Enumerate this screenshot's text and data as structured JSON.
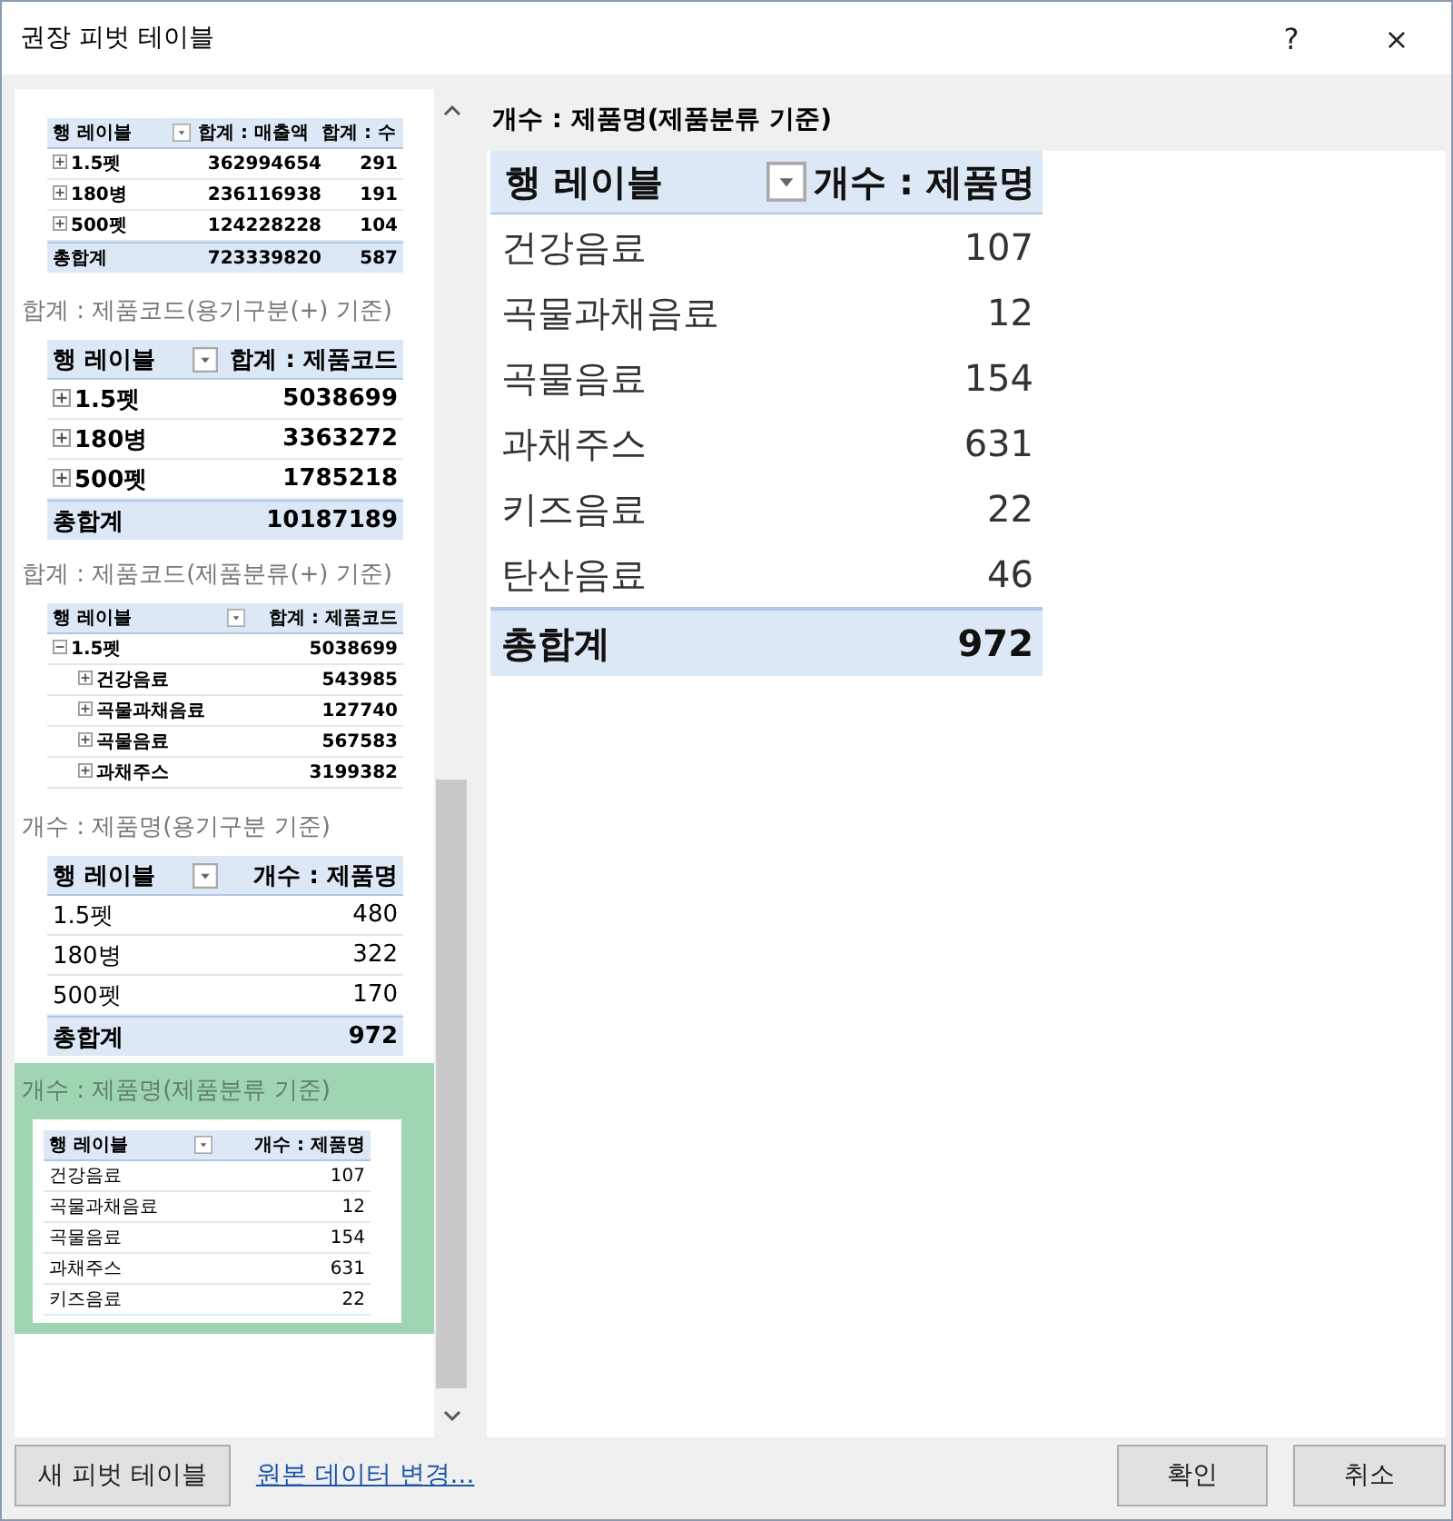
{
  "window": {
    "title": "권장 피벗 테이블",
    "help": "?",
    "close": "×"
  },
  "recommendations": [
    {
      "kind": "compact",
      "selected": false,
      "table": {
        "bold_rows": true,
        "headers": [
          "행 레이블",
          "합계 : 매출액",
          "합계 : 수"
        ],
        "rows": [
          {
            "label": "1.5펫",
            "values": [
              "362994654",
              "291"
            ],
            "expanded": false
          },
          {
            "label": "180병",
            "values": [
              "236116938",
              "191"
            ],
            "expanded": false
          },
          {
            "label": "500펫",
            "values": [
              "124228228",
              "104"
            ],
            "expanded": false
          }
        ],
        "total": {
          "label": "총합계",
          "values": [
            "723339820",
            "587"
          ]
        }
      }
    },
    {
      "kind": "full",
      "selected": false,
      "title": "합계 : 제품코드(용기구분(+) 기준)",
      "table": {
        "bold_rows": true,
        "headers": [
          "행 레이블",
          "합계 : 제품코드"
        ],
        "rows": [
          {
            "label": "1.5펫",
            "values": [
              "5038699"
            ],
            "expanded": false
          },
          {
            "label": "180병",
            "values": [
              "3363272"
            ],
            "expanded": false
          },
          {
            "label": "500펫",
            "values": [
              "1785218"
            ],
            "expanded": false
          }
        ],
        "total": {
          "label": "총합계",
          "values": [
            "10187189"
          ]
        }
      }
    },
    {
      "kind": "compact",
      "selected": false,
      "title": "합계 : 제품코드(제품분류(+) 기준)",
      "table": {
        "bold_rows": true,
        "headers": [
          "행 레이블",
          "합계 : 제품코드"
        ],
        "rows": [
          {
            "label": "1.5펫",
            "values": [
              "5038699"
            ],
            "expanded": true,
            "children": [
              {
                "label": "건강음료",
                "values": [
                  "543985"
                ],
                "expanded": false
              },
              {
                "label": "곡물과채음료",
                "values": [
                  "127740"
                ],
                "expanded": false
              },
              {
                "label": "곡물음료",
                "values": [
                  "567583"
                ],
                "expanded": false
              },
              {
                "label": "과채주스",
                "values": [
                  "3199382"
                ],
                "expanded": false
              }
            ]
          }
        ]
      }
    },
    {
      "kind": "full",
      "selected": false,
      "title": "개수 : 제품명(용기구분 기준)",
      "table": {
        "bold_rows": false,
        "headers": [
          "행 레이블",
          "개수 : 제품명"
        ],
        "rows": [
          {
            "label": "1.5펫",
            "values": [
              "480"
            ]
          },
          {
            "label": "180병",
            "values": [
              "322"
            ]
          },
          {
            "label": "500펫",
            "values": [
              "170"
            ]
          }
        ],
        "total": {
          "label": "총합계",
          "values": [
            "972"
          ]
        }
      }
    },
    {
      "kind": "compact",
      "selected": true,
      "title": "개수 : 제품명(제품분류 기준)",
      "table": {
        "bold_rows": false,
        "headers": [
          "행 레이블",
          "개수 : 제품명"
        ],
        "rows": [
          {
            "label": "건강음료",
            "values": [
              "107"
            ]
          },
          {
            "label": "곡물과채음료",
            "values": [
              "12"
            ]
          },
          {
            "label": "곡물음료",
            "values": [
              "154"
            ]
          },
          {
            "label": "과채주스",
            "values": [
              "631"
            ]
          },
          {
            "label": "키즈음료",
            "values": [
              "22"
            ]
          }
        ]
      }
    }
  ],
  "preview": {
    "title": "개수 : 제품명(제품분류 기준)",
    "headers": [
      "행 레이블",
      "개수 : 제품명"
    ],
    "rows": [
      {
        "label": "건강음료",
        "value": "107"
      },
      {
        "label": "곡물과채음료",
        "value": "12"
      },
      {
        "label": "곡물음료",
        "value": "154"
      },
      {
        "label": "과채주스",
        "value": "631"
      },
      {
        "label": "키즈음료",
        "value": "22"
      },
      {
        "label": "탄산음료",
        "value": "46"
      }
    ],
    "total": {
      "label": "총합계",
      "value": "972"
    }
  },
  "footer": {
    "new_button": "새 피벗 테이블",
    "change_link": "원본 데이터 변경...",
    "ok": "확인",
    "cancel": "취소"
  }
}
